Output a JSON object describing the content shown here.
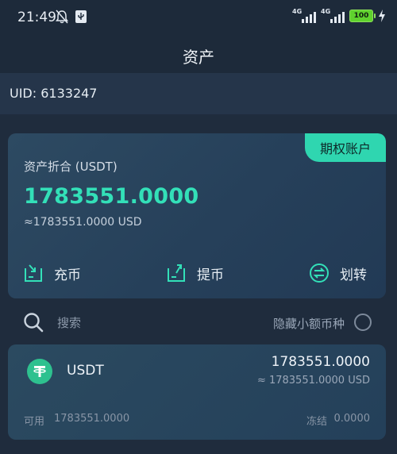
{
  "status_bar": {
    "time": "21:49",
    "network_1": "4G",
    "network_2": "4G",
    "battery": "100"
  },
  "header": {
    "title": "资产"
  },
  "account": {
    "uid": "UID: 6133247"
  },
  "asset_card": {
    "badge": "期权账户",
    "label": "资产折合 (USDT)",
    "amount": "1783551.0000",
    "usd_equiv": "≈1783551.0000 USD",
    "actions": {
      "deposit": "充币",
      "withdraw": "提币",
      "transfer": "划转"
    }
  },
  "search": {
    "placeholder": "搜索",
    "hide_small": "隐藏小额币种"
  },
  "coin": {
    "name": "USDT",
    "amount": "1783551.0000",
    "usd": "≈ 1783551.0000 USD",
    "available_label": "可用",
    "available_value": "1783551.0000",
    "frozen_label": "冻结",
    "frozen_value": "0.0000"
  },
  "colors": {
    "accent": "#33e0b8",
    "badge": "#2fd6b0",
    "background": "#1f2c3d",
    "card": "#2b4a60"
  }
}
